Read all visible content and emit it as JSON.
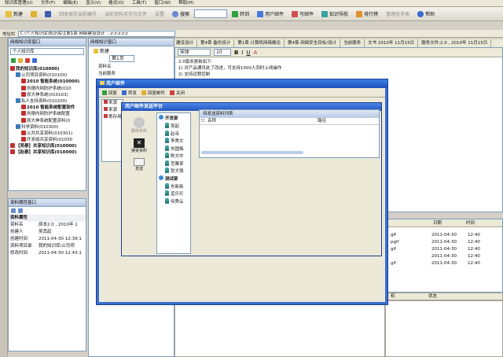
{
  "menubar": {
    "items": [
      "知识库管理(U)",
      "文件(F)",
      "编辑(E)",
      "显示(V)",
      "格式(O)",
      "工具(T)",
      "窗口(W)",
      "帮助(H)"
    ]
  },
  "toolbar1": {
    "new_label": "新建",
    "dis1": "回收保存当前编号",
    "dis2": "当前资料另存为文件",
    "dis3": "设置",
    "search_label": "搜索",
    "goto_label": "转到",
    "user_mail_label": "用户邮件",
    "write_mail_label": "写邮件",
    "knowledge_nav_label": "知识导航",
    "rank_label": "排行榜",
    "manage_label": "管理员手册",
    "help_label": "帮助"
  },
  "address": {
    "label": "地址栏",
    "value": "C:\\个人知识库\\知识库\\1第1章 网络建设设计 : :z:z:z:z:z"
  },
  "tabs": [
    "建设设计",
    "第4章 备份设计",
    "第1章 计算机网络概论",
    "第4章 网络安全目标/设计",
    "当前服务",
    "文书 2010年 11月15日",
    "服务文件:2.0 , 2010年 11月15日"
  ],
  "left_panel": {
    "title": "网络知识库窗口",
    "combo": "个人知识库",
    "tree": [
      {
        "text": "我的知识库(010000)",
        "indent": 0,
        "bold": true,
        "color": "#c03030"
      },
      {
        "text": "公司项目资料(010100)",
        "indent": 1,
        "bold": false,
        "color": "#3a7ac0"
      },
      {
        "text": "2010 智能系统(010000)",
        "indent": 2,
        "bold": true,
        "color": "#c03030"
      },
      {
        "text": "刘德内网防护系统(010",
        "indent": 2,
        "bold": false,
        "color": "#c03030"
      },
      {
        "text": "原大神系统(010103)",
        "indent": 2,
        "bold": false,
        "color": "#c03030"
      },
      {
        "text": "私人支持资料(010200)",
        "indent": 1,
        "bold": false,
        "color": "#3a7ac0"
      },
      {
        "text": "2010 智能系统配置软件",
        "indent": 2,
        "bold": true,
        "color": "#c03030"
      },
      {
        "text": "刘德内网防护系统配置",
        "indent": 2,
        "bold": false,
        "color": "#c03030"
      },
      {
        "text": "原大神系统配置资料(0",
        "indent": 2,
        "bold": false,
        "color": "#c03030"
      },
      {
        "text": "科学资料(010300)",
        "indent": 1,
        "bold": false,
        "color": "#3a7ac0"
      },
      {
        "text": "公共共享资料(010301)",
        "indent": 2,
        "bold": false,
        "color": "#c03030"
      },
      {
        "text": "开发组共享资料(01030",
        "indent": 2,
        "bold": false,
        "color": "#c03030"
      },
      {
        "text": "【吴泰】共享知识库(010000)",
        "indent": 0,
        "bold": true,
        "color": "#c03030"
      },
      {
        "text": "【赵泰】共享知识库(010000)",
        "indent": 0,
        "bold": true,
        "color": "#c03030"
      }
    ]
  },
  "props_panel": {
    "title": "资料属性窗口",
    "section": "资料属性",
    "rows": [
      {
        "k": "资料名",
        "v": "原本2.0 , 2010年 1"
      },
      {
        "k": "创建人",
        "v": "吴其起"
      },
      {
        "k": "创建时间",
        "v": "2011-04-30 12:39:1"
      },
      {
        "k": "资料项目录",
        "v": "我的知识库\\公司项"
      },
      {
        "k": "修改时间",
        "v": "2011-04-30 12:43:1"
      }
    ]
  },
  "mid_panel": {
    "title": "网络知识窗口",
    "new_label": "新建",
    "page_label": "第1页",
    "items": [
      "资料名",
      "当前服务"
    ]
  },
  "editor": {
    "font": "宋体",
    "size": "10",
    "lines": [
      "2.0版本更新如下:",
      "1) 对产品通讯处了改进，可支持1000人同时上线操作",
      "2) 支持远程控制"
    ]
  },
  "attach_panel": {
    "headers": [
      "日期",
      "时间"
    ],
    "rows": [
      {
        "name": "gif",
        "date": "2011-04-30",
        "time": "12:40"
      },
      {
        "name": "pgif",
        "date": "2011-04-30",
        "time": "12:40"
      },
      {
        "name": "gif",
        "date": "2011-04-30",
        "time": "12:40"
      },
      {
        "name": "",
        "date": "2011-04-30",
        "time": "12:40"
      },
      {
        "name": "gif",
        "date": "2011-04-30",
        "time": "12:40"
      }
    ],
    "status_headers": [
      "机",
      "状态"
    ]
  },
  "mail_dialog": {
    "title": "用户邮件",
    "toolbar": [
      "回复",
      "转发",
      "回复邮件",
      "关闭"
    ],
    "left_items": [
      "来源",
      "来源",
      "寄存用"
    ],
    "sidebar": [
      "删除资料",
      "接受资料",
      "发送"
    ],
    "inner_title": "用户邮件发送平台",
    "list_title": "待发送资料列表",
    "groups": [
      {
        "name": "开发部",
        "members": [
          "吴起",
          "赵寺",
          "李秀文",
          "刘国梅",
          "陈文中",
          "范雅草",
          "张文强"
        ]
      },
      {
        "name": "测试部",
        "members": [
          "东新新",
          "孟乐乐",
          "何秀云"
        ]
      }
    ],
    "columns": [
      "名称",
      "路径"
    ]
  }
}
